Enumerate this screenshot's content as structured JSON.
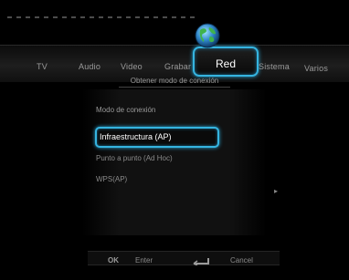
{
  "tabs": [
    {
      "label": "TV"
    },
    {
      "label": "Audio"
    },
    {
      "label": "Video"
    },
    {
      "label": "Grabar"
    },
    {
      "label": "Red",
      "active": true
    },
    {
      "label": "Sistema"
    },
    {
      "label": "Varios"
    }
  ],
  "active_tab_icon": "globe-icon",
  "subtitle": "Obtener modo de conexión",
  "menu": {
    "heading": "Modo de conexión",
    "options": [
      {
        "label": "Infraestructura (AP)",
        "selected": true
      },
      {
        "label": "Punto a punto (Ad Hoc)"
      },
      {
        "label": "WPS(AP)"
      }
    ]
  },
  "footer": {
    "ok_key": "OK",
    "ok_action": "Enter",
    "return_icon": "return-arrow-icon",
    "return_action": "Cancel"
  },
  "colors": {
    "accent": "#35b4e0",
    "background": "#000000"
  }
}
